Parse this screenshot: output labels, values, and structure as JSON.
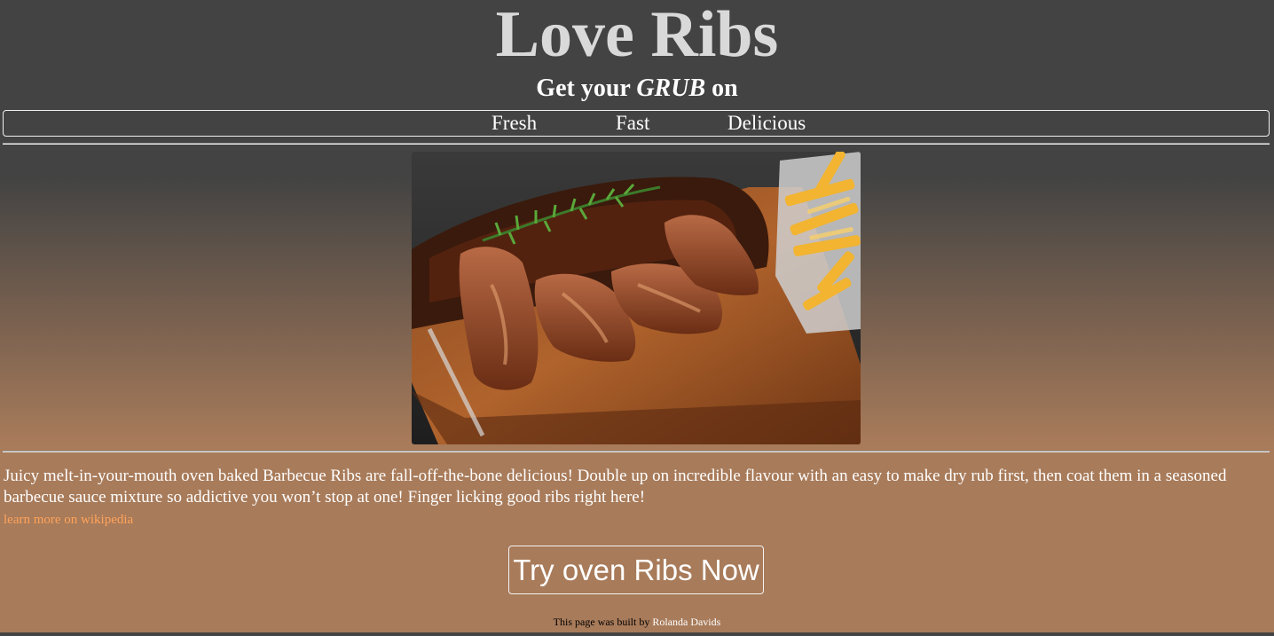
{
  "header": {
    "title": "Love Ribs",
    "subtitle_prefix": "Get your ",
    "subtitle_emphasis": "GRUB",
    "subtitle_suffix": " on"
  },
  "nav": {
    "items": [
      {
        "label": "Fresh"
      },
      {
        "label": "Fast"
      },
      {
        "label": "Delicious"
      }
    ]
  },
  "hero": {
    "image_icon": "ribs-photo"
  },
  "content": {
    "description": "Juicy melt-in-your-mouth oven baked Barbecue Ribs are fall-off-the-bone delicious! Double up on incredible flavour with an easy to make dry rub first, then coat them in a seasoned barbecue sauce mixture so addictive you won’t stop at one! Finger licking good ribs right here!",
    "link_label": "learn more on wikipedia"
  },
  "cta": {
    "label": "Try oven Ribs Now"
  },
  "footer": {
    "text": "This page was built by ",
    "author": "Rolanda Davids"
  },
  "colors": {
    "background_top": "#434343",
    "background_bottom": "#a87b5a",
    "link": "#ffa35a",
    "title": "#d9d9d9"
  }
}
